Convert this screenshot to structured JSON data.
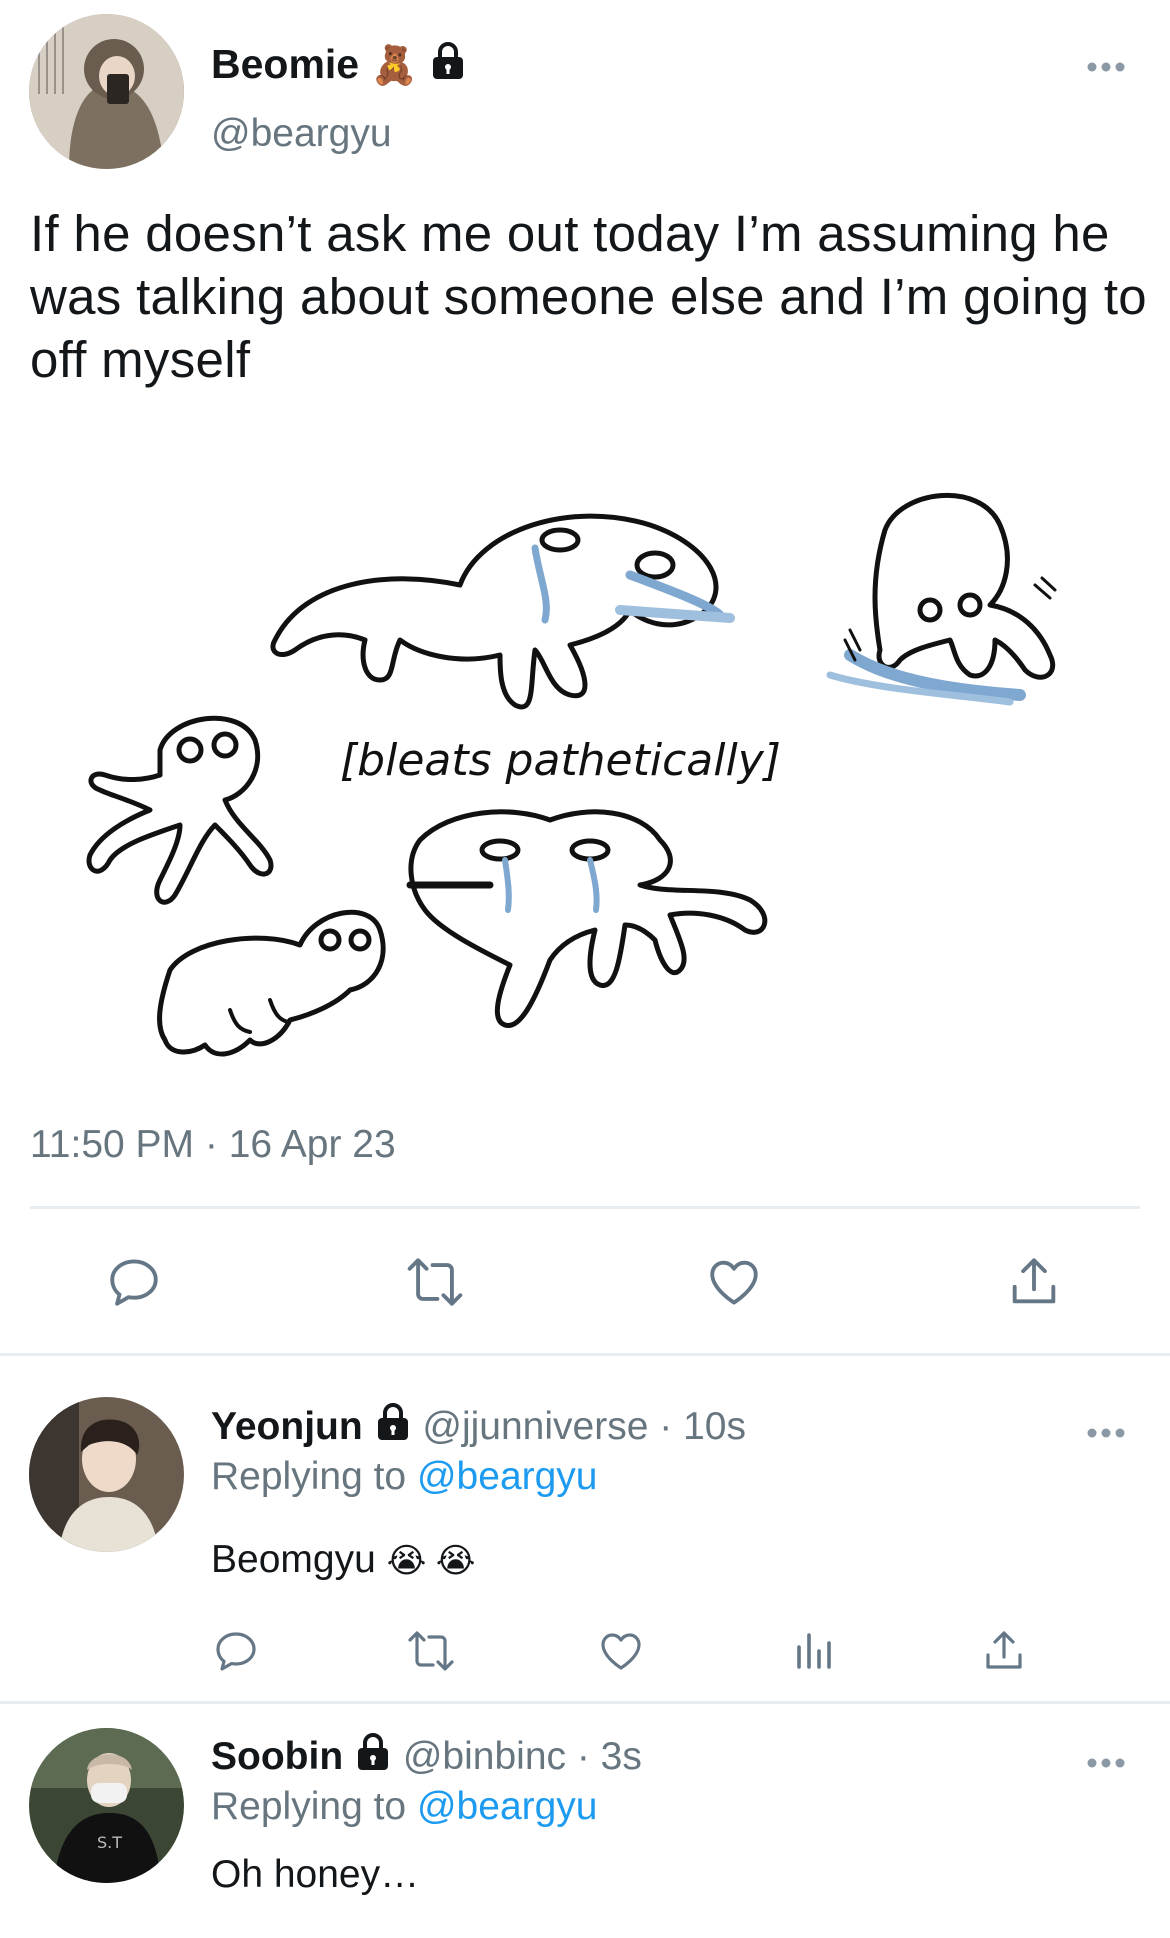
{
  "main_tweet": {
    "display_name": "Beomie",
    "name_emoji": "🧸",
    "handle": "@beargyu",
    "text": "If he doesn’t ask me out today I’m assuming he was talking about someone else and I’m going to off myself",
    "image_caption": "[bleats pathetically]",
    "timestamp": "11:50 PM · 16 Apr 23"
  },
  "replies": [
    {
      "display_name": "Yeonjun",
      "handle": "@jjunniverse",
      "time": "· 10s",
      "replying_prefix": "Replying to",
      "replying_to": "@beargyu",
      "text": "Beomgyu",
      "emojis": "😭 😭"
    },
    {
      "display_name": "Soobin",
      "handle": "@binbinc",
      "time": "· 3s",
      "replying_prefix": "Replying to",
      "replying_to": "@beargyu",
      "text": "Oh honey…"
    }
  ],
  "icons": {
    "more": "more-horizontal-icon",
    "reply": "reply-icon",
    "retweet": "retweet-icon",
    "like": "heart-icon",
    "share": "share-icon",
    "views": "bar-chart-icon",
    "lock": "lock-icon"
  },
  "colors": {
    "link": "#1d9bf0",
    "secondary_text": "#67757f",
    "tear_blue": "#7fa8d1"
  }
}
